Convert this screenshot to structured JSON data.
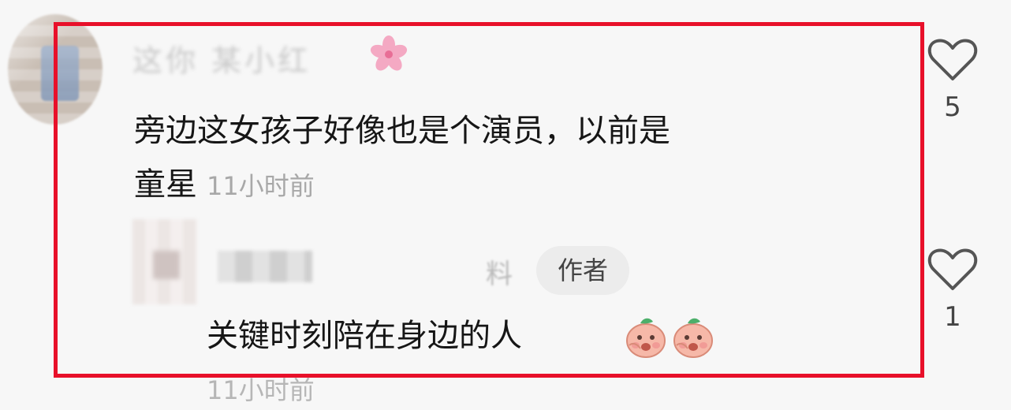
{
  "comment": {
    "username_blurred": "这你 某小红",
    "text_line1": "旁边这女孩子好像也是个演员，以前是",
    "text_line2": "童星",
    "time": "11小时前",
    "like_count": "5"
  },
  "reply": {
    "username_tail": "料",
    "author_badge": "作者",
    "text": "关键时刻陪在身边的人",
    "time": "11小时前",
    "like_count": "1"
  },
  "colors": {
    "highlight_border": "#e8102a",
    "badge_bg": "#ececec",
    "time_text": "#a8a8a8"
  },
  "icons": [
    "cherry-blossom-icon",
    "heart-outline-icon",
    "peach-emoji-icon"
  ]
}
